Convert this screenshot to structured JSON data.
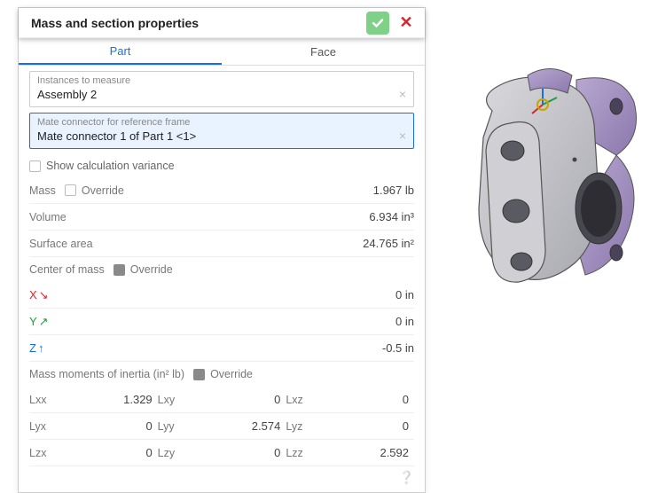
{
  "header": {
    "title": "Mass and section properties"
  },
  "tabs": {
    "part": "Part",
    "face": "Face"
  },
  "instances_field": {
    "label": "Instances to measure",
    "value": "Assembly 2"
  },
  "mate_field": {
    "label": "Mate connector for reference frame",
    "value": "Mate connector 1 of Part 1 <1>"
  },
  "show_variance": "Show calculation variance",
  "override_label": "Override",
  "mass_label": "Mass",
  "mass_value": "1.967 lb",
  "volume_label": "Volume",
  "volume_value": "6.934 in³",
  "surface_label": "Surface area",
  "surface_value": "24.765 in²",
  "com_label": "Center of mass",
  "com": {
    "x": {
      "label": "X",
      "arrow": "↘",
      "value": "0 in"
    },
    "y": {
      "label": "Y",
      "arrow": "↗",
      "value": "0 in"
    },
    "z": {
      "label": "Z",
      "arrow": "↑",
      "value": "-0.5 in"
    }
  },
  "inertia_label": "Mass moments of inertia (in² lb)",
  "inertia": {
    "Lxx": "1.329",
    "Lxy": "0",
    "Lxz": "0",
    "Lyx": "0",
    "Lyy": "2.574",
    "Lyz": "0",
    "Lzx": "0",
    "Lzy": "0",
    "Lzz": "2.592"
  },
  "labels": {
    "Lxx": "Lxx",
    "Lxy": "Lxy",
    "Lxz": "Lxz",
    "Lyx": "Lyx",
    "Lyy": "Lyy",
    "Lyz": "Lyz",
    "Lzx": "Lzx",
    "Lzy": "Lzy",
    "Lzz": "Lzz"
  }
}
